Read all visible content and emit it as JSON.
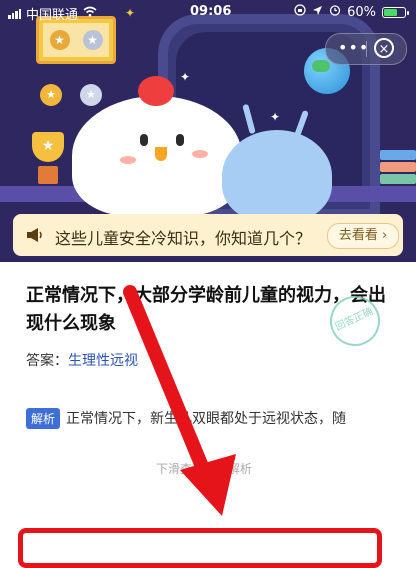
{
  "status_bar": {
    "carrier": "中国联通",
    "time": "09:06",
    "battery": "60%"
  },
  "hero": {
    "banner_text": "这些儿童安全冷知识，你知道几个？",
    "banner_button": "去看看 ›"
  },
  "capsule": {
    "more": "•••",
    "close": "×"
  },
  "question": {
    "text": "正常情况下，大部分学龄前儿童的视力，会出现什么现象",
    "answer_label": "答案：",
    "answer_value": "生理性远视",
    "stamp": "回答正确",
    "analysis_tag": "解析",
    "analysis_text": "正常情况下，新生儿双眼都处于远视状态，随",
    "scroll_hint": "下滑查看答案解析"
  },
  "colors": {
    "accent_red": "#e5141a",
    "tag_blue": "#3f6fd6",
    "hero_bg": "#2e2760"
  }
}
